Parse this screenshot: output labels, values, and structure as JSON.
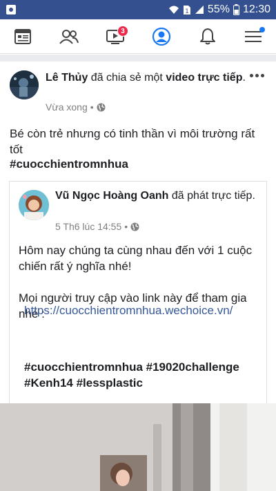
{
  "status_bar": {
    "battery_percent": "55%",
    "time": "12:30"
  },
  "tab_bar": {
    "tabs": [
      {
        "name": "news-feed",
        "icon": "news-feed-icon"
      },
      {
        "name": "friends",
        "icon": "friends-icon"
      },
      {
        "name": "watch",
        "icon": "video-icon",
        "badge": "3"
      },
      {
        "name": "profile",
        "icon": "profile-icon"
      },
      {
        "name": "notifications",
        "icon": "bell-icon"
      },
      {
        "name": "menu",
        "icon": "hamburger-menu-icon"
      }
    ],
    "accent": "#1877f2"
  },
  "post": {
    "author": "Lê Thủy",
    "action": " đã chia sẻ một ",
    "object": "video trực tiếp",
    "period": ".",
    "time": "Vừa xong",
    "separator": "•",
    "caption": "Bé còn trẻ nhưng có tinh thần vì môi trường rất tốt",
    "hashtag": "#cuocchientromnhua",
    "shared": {
      "author": "Vũ Ngọc Hoàng Oanh",
      "action": " đã phát trực tiếp.",
      "time": "5 Th6 lúc 14:55",
      "separator": "•",
      "paragraph1": "Hôm nay chúng ta cùng nhau đến với 1 cuộc chiến rất ý nghĩa nhé!",
      "paragraph2": "Mọi người truy cập vào link này để tham gia nhé :",
      "link": "https://cuocchientromnhua.wechoice.vn/",
      "tags": "#cuocchientromnhua #19020challenge #Kenh14 #lessplastic"
    }
  }
}
